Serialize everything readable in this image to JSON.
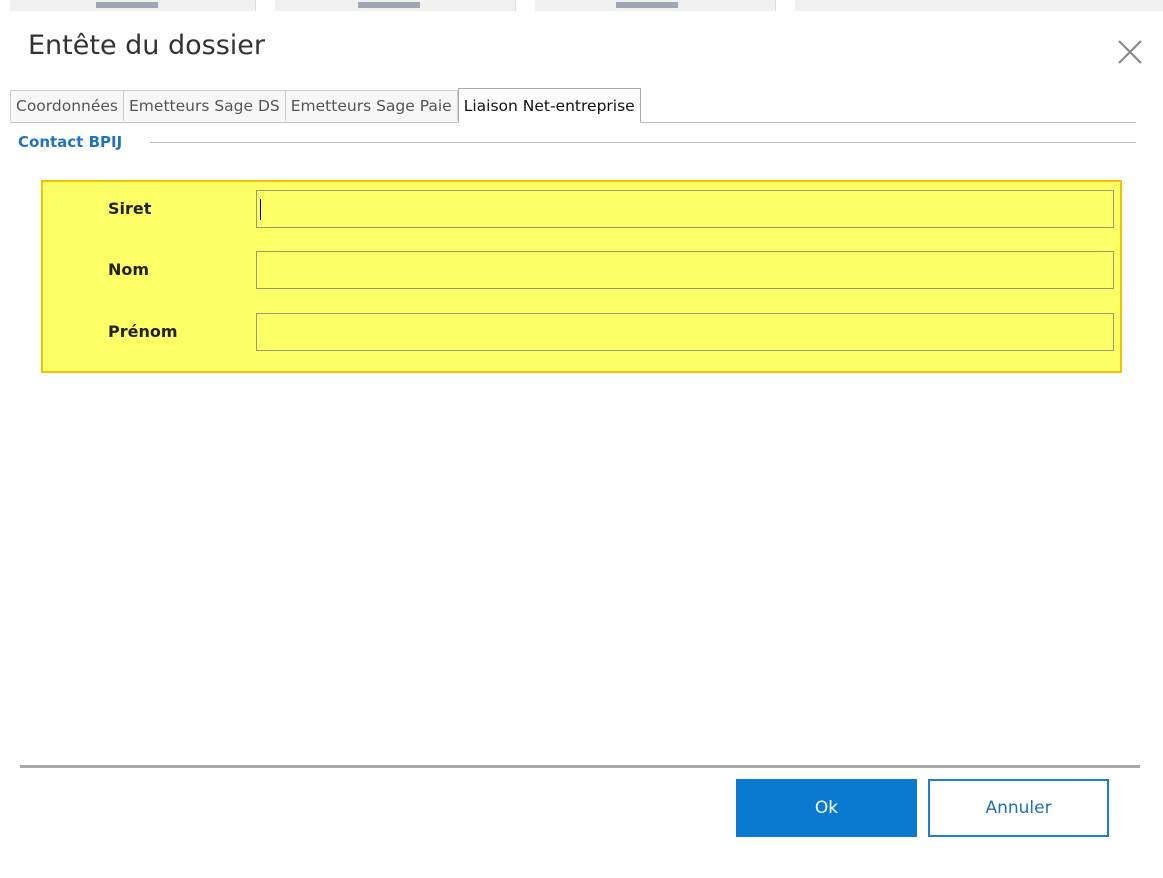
{
  "dialog": {
    "title": "Entête du dossier",
    "close_icon": "close-icon"
  },
  "tabs": [
    {
      "label": "Coordonnées",
      "active": false
    },
    {
      "label": "Emetteurs Sage DS",
      "active": false
    },
    {
      "label": "Emetteurs Sage Paie",
      "active": false
    },
    {
      "label": "Liaison Net-entreprise",
      "active": true
    }
  ],
  "group": {
    "label": "Contact BPIJ"
  },
  "fields": [
    {
      "label": "Siret",
      "value": ""
    },
    {
      "label": "Nom",
      "value": ""
    },
    {
      "label": "Prénom",
      "value": ""
    }
  ],
  "buttons": {
    "ok_label": "Ok",
    "cancel_label": "Annuler"
  },
  "colors": {
    "accent": "#0a7ad0",
    "group_label": "#1f74c2",
    "highlight_fill": "#ffff66",
    "highlight_border": "#f3c300"
  }
}
